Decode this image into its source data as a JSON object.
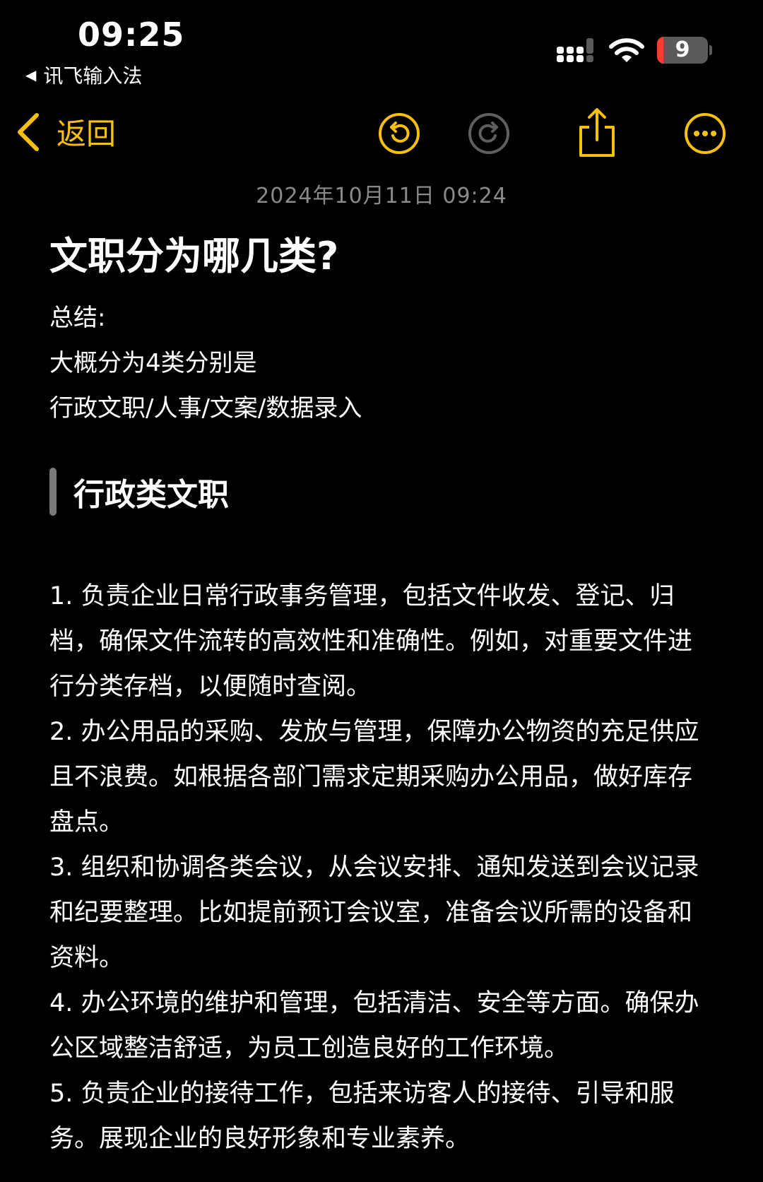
{
  "status_bar": {
    "time": "09:25",
    "back_app_label": "讯飞输入法",
    "battery_level": "9",
    "signal_icon": "cellular-signal-icon",
    "wifi_icon": "wifi-icon",
    "battery_icon": "battery-icon",
    "battery_low_color": "#ff3b30"
  },
  "toolbar": {
    "back_label": "返回",
    "accent_color": "#f7c00e",
    "icons": {
      "back": "chevron-left-icon",
      "undo": "undo-icon",
      "redo": "redo-icon",
      "share": "share-icon",
      "more": "more-icon"
    }
  },
  "note": {
    "date": "2024年10月11日 09:24",
    "title": "文职分为哪几类?",
    "summary_lines": [
      "总结:",
      "大概分为4类分别是",
      "行政文职/人事/文案/数据录入"
    ],
    "section_heading": "行政类文职",
    "items": [
      "1. 负责企业日常行政事务管理，包括文件收发、登记、归档，确保文件流转的高效性和准确性。例如，对重要文件进行分类存档，以便随时查阅。",
      "2. 办公用品的采购、发放与管理，保障办公物资的充足供应且不浪费。如根据各部门需求定期采购办公用品，做好库存盘点。",
      "3. 组织和协调各类会议，从会议安排、通知发送到会议记录和纪要整理。比如提前预订会议室，准备会议所需的设备和资料。",
      "4. 办公环境的维护和管理，包括清洁、安全等方面。确保办公区域整洁舒适，为员工创造良好的工作环境。",
      "5. 负责企业的接待工作，包括来访客人的接待、引导和服务。展现企业的良好形象和专业素养。"
    ]
  }
}
